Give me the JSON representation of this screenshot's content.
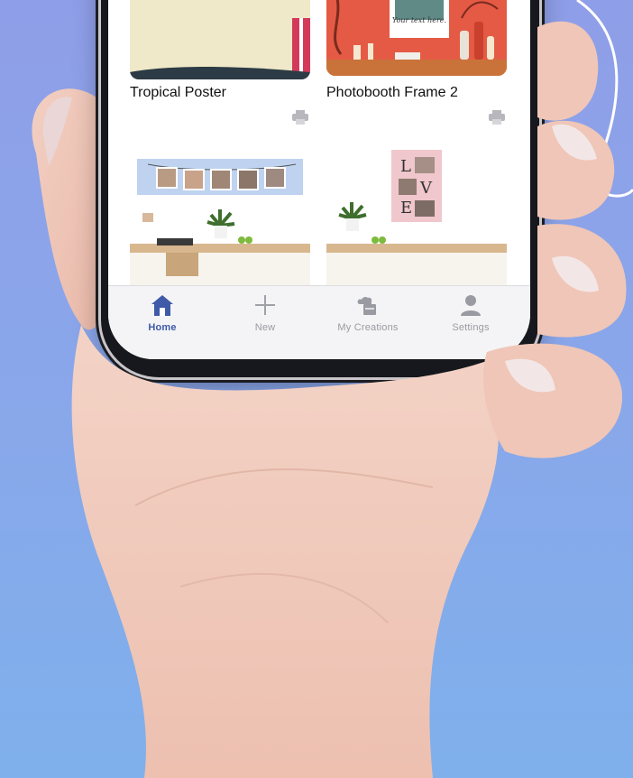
{
  "colors": {
    "background_top": "#8f9ee8",
    "background_bottom": "#7fb0ec",
    "active_tab": "#3e5aa8",
    "inactive_tab": "#9a9aa2"
  },
  "cards": [
    {
      "title": "Tropical Poster",
      "icon": "printer-icon"
    },
    {
      "title": "Photobooth Frame 2",
      "icon": "printer-icon",
      "frame_text": "Your text here."
    },
    {
      "title": "",
      "icon": ""
    },
    {
      "title": "",
      "icon": ""
    }
  ],
  "tabbar": {
    "items": [
      {
        "label": "Home",
        "icon": "home-icon",
        "active": true
      },
      {
        "label": "New",
        "icon": "plus-icon",
        "active": false
      },
      {
        "label": "My Creations",
        "icon": "cloud-folder-icon",
        "active": false
      },
      {
        "label": "Settings",
        "icon": "person-icon",
        "active": false
      }
    ]
  }
}
